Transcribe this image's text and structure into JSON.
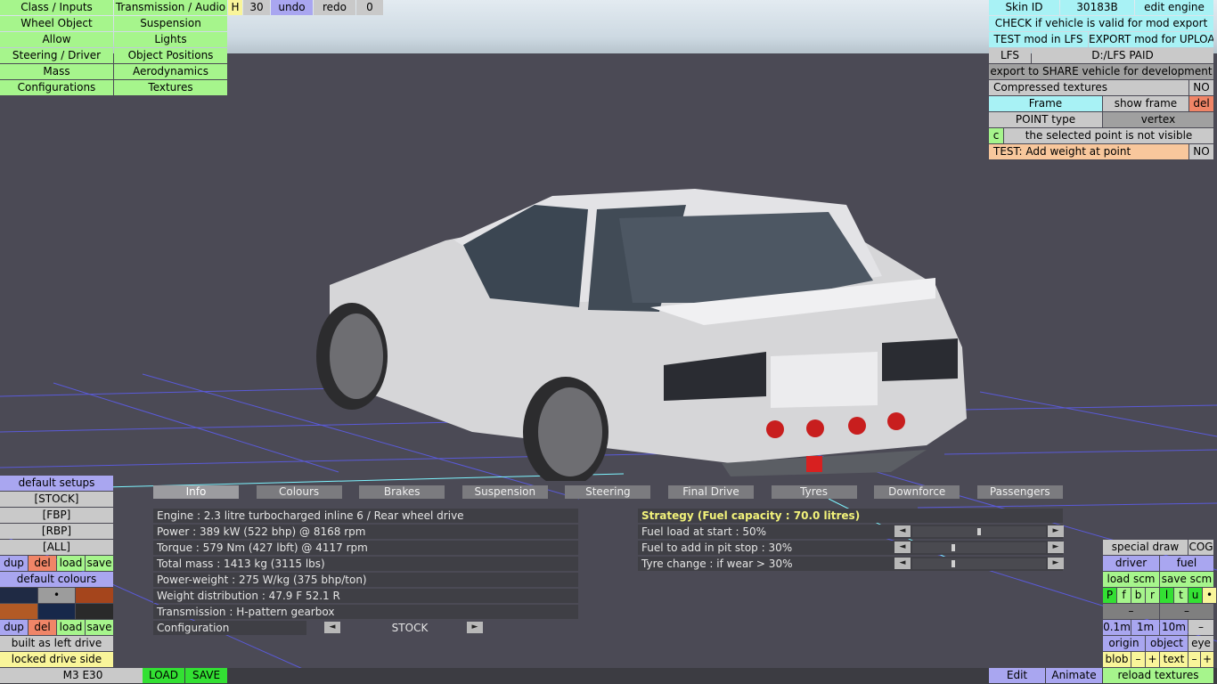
{
  "app": {
    "vehicle_name": "M3 E30",
    "load_label": "LOAD",
    "save_label": "SAVE"
  },
  "top_left_menu": [
    [
      "Class / Inputs",
      "Transmission / Audio"
    ],
    [
      "Wheel Object",
      "Suspension"
    ],
    [
      "Allow",
      "Lights"
    ],
    [
      "Steering / Driver",
      "Object Positions"
    ],
    [
      "Mass",
      "Aerodynamics"
    ],
    [
      "Configurations",
      "Textures"
    ]
  ],
  "top_toolbar": {
    "h_label": "H",
    "number": "30",
    "undo": "undo",
    "redo": "redo",
    "count": "0"
  },
  "top_right": {
    "skin_id_label": "Skin ID",
    "skin_id_value": "30183B",
    "edit_engine": "edit engine",
    "check_valid": "CHECK if vehicle is valid for mod export",
    "test_mod": "TEST mod in LFS",
    "export_mod": "EXPORT mod for UPLOAD",
    "lfs_label": "LFS",
    "lfs_path": "D:/LFS PAID",
    "export_share": "export to SHARE vehicle for development",
    "compressed_label": "Compressed textures",
    "compressed_value": "NO",
    "frame": "Frame",
    "show_frame": "show frame",
    "del": "del",
    "point_type_label": "POINT type",
    "point_type_value": "vertex",
    "c_label": "c",
    "point_status": "the selected point is not visible",
    "test_weight": "TEST: Add weight at point",
    "test_weight_value": "NO"
  },
  "left_panel": {
    "default_setups": "default setups",
    "setups": [
      "[STOCK]",
      "[FBP]",
      "[RBP]",
      "[ALL]"
    ],
    "dup": "dup",
    "del": "del",
    "load": "load",
    "save": "save",
    "default_colours": "default colours",
    "swatch_colors": [
      "#1f2a44",
      "#9c9c9c",
      "#a5451c",
      "#b25a25",
      "#17284a",
      "#2a2a2a"
    ],
    "swatch_dot": "•",
    "built_as": "built as left drive",
    "locked": "locked drive side"
  },
  "tabs": [
    "Info",
    "Colours",
    "Brakes",
    "Suspension",
    "Steering",
    "Final Drive",
    "Tyres",
    "Downforce",
    "Passengers"
  ],
  "info": {
    "rows": [
      "Engine : 2.3 litre turbocharged inline 6 / Rear wheel drive",
      "Power : 389 kW (522 bhp) @ 8168 rpm",
      "Torque : 579 Nm (427 lbft) @ 4117 rpm",
      "Total mass : 1413 kg (3115 lbs)",
      "Power-weight : 275 W/kg (375 bhp/ton)",
      "Weight distribution : 47.9 F  52.1 R",
      "Transmission : H-pattern gearbox"
    ],
    "configuration_label": "Configuration",
    "configuration_value": "STOCK"
  },
  "strategy": {
    "title": "Strategy (Fuel capacity : 70.0 litres)",
    "rows": [
      {
        "label": "Fuel load at start : 50%",
        "value": 0.5
      },
      {
        "label": "Fuel to add in pit stop : 30%",
        "value": 0.3
      },
      {
        "label": "Tyre change : if wear > 30%",
        "value": 0.3
      }
    ]
  },
  "right_panel": {
    "special_draw": "special draw",
    "cog": "COG",
    "driver": "driver",
    "fuel": "fuel",
    "load_scm": "load scm",
    "save_scm": "save scm",
    "letters": [
      "P",
      "f",
      "b",
      "r",
      "l",
      "t",
      "u",
      "•"
    ],
    "minus": "–",
    "scales": [
      "0.1m",
      "1m",
      "10m",
      "–"
    ],
    "origin": "origin",
    "object": "object",
    "eye": "eye",
    "blob": "blob",
    "plus": "+",
    "text": "text",
    "reload": "reload textures"
  },
  "bottom_bar": {
    "edit": "Edit",
    "animate": "Animate"
  },
  "colors": {
    "green": "#a6f58c",
    "cyan": "#a8f2f5",
    "blue": "#a9a6f0",
    "yellow": "#f9f59a",
    "red": "#f08567"
  }
}
